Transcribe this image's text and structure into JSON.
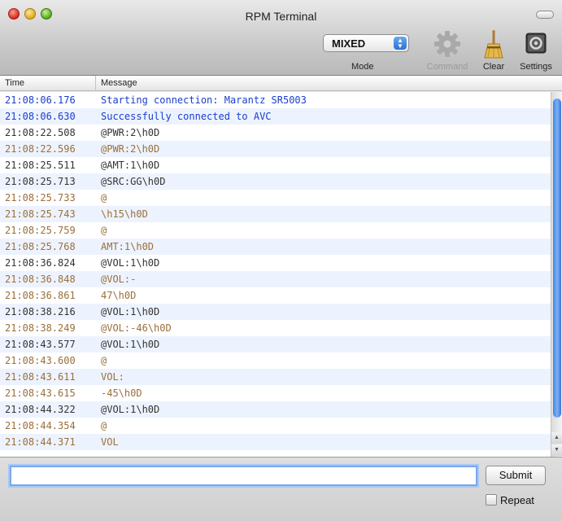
{
  "window": {
    "title": "RPM Terminal"
  },
  "toolbar": {
    "mode_value": "MIXED",
    "mode_label": "Mode",
    "command_label": "Command",
    "clear_label": "Clear",
    "settings_label": "Settings"
  },
  "table": {
    "headers": {
      "time": "Time",
      "message": "Message"
    },
    "rows": [
      {
        "time": "21:08:06.176",
        "message": "Starting connection: Marantz SR5003",
        "kind": "info"
      },
      {
        "time": "21:08:06.630",
        "message": "Successfully connected to AVC",
        "kind": "info"
      },
      {
        "time": "21:08:22.508",
        "message": "@PWR:2\\h0D",
        "kind": "recv"
      },
      {
        "time": "21:08:22.596",
        "message": "@PWR:2\\h0D",
        "kind": "sent"
      },
      {
        "time": "21:08:25.511",
        "message": "@AMT:1\\h0D",
        "kind": "recv"
      },
      {
        "time": "21:08:25.713",
        "message": "@SRC:GG\\h0D",
        "kind": "recv"
      },
      {
        "time": "21:08:25.733",
        "message": "@",
        "kind": "sent"
      },
      {
        "time": "21:08:25.743",
        "message": "\\h15\\h0D",
        "kind": "sent"
      },
      {
        "time": "21:08:25.759",
        "message": "@",
        "kind": "sent"
      },
      {
        "time": "21:08:25.768",
        "message": "AMT:1\\h0D",
        "kind": "sent"
      },
      {
        "time": "21:08:36.824",
        "message": "@VOL:1\\h0D",
        "kind": "recv"
      },
      {
        "time": "21:08:36.848",
        "message": "@VOL:-",
        "kind": "sent"
      },
      {
        "time": "21:08:36.861",
        "message": "47\\h0D",
        "kind": "sent"
      },
      {
        "time": "21:08:38.216",
        "message": "@VOL:1\\h0D",
        "kind": "recv"
      },
      {
        "time": "21:08:38.249",
        "message": "@VOL:-46\\h0D",
        "kind": "sent"
      },
      {
        "time": "21:08:43.577",
        "message": "@VOL:1\\h0D",
        "kind": "recv"
      },
      {
        "time": "21:08:43.600",
        "message": "@",
        "kind": "sent"
      },
      {
        "time": "21:08:43.611",
        "message": "VOL:",
        "kind": "sent"
      },
      {
        "time": "21:08:43.615",
        "message": "-45\\h0D",
        "kind": "sent"
      },
      {
        "time": "21:08:44.322",
        "message": "@VOL:1\\h0D",
        "kind": "recv"
      },
      {
        "time": "21:08:44.354",
        "message": "@",
        "kind": "sent"
      },
      {
        "time": "21:08:44.371",
        "message": "VOL",
        "kind": "sent"
      }
    ]
  },
  "input": {
    "value": ""
  },
  "buttons": {
    "submit": "Submit",
    "repeat_label": "Repeat",
    "repeat_checked": false
  },
  "colors": {
    "info": "#1a3ecf",
    "received": "#333333",
    "sent": "#9a6f3a"
  },
  "icons": [
    "gear-icon",
    "broom-icon",
    "settings-icon"
  ]
}
